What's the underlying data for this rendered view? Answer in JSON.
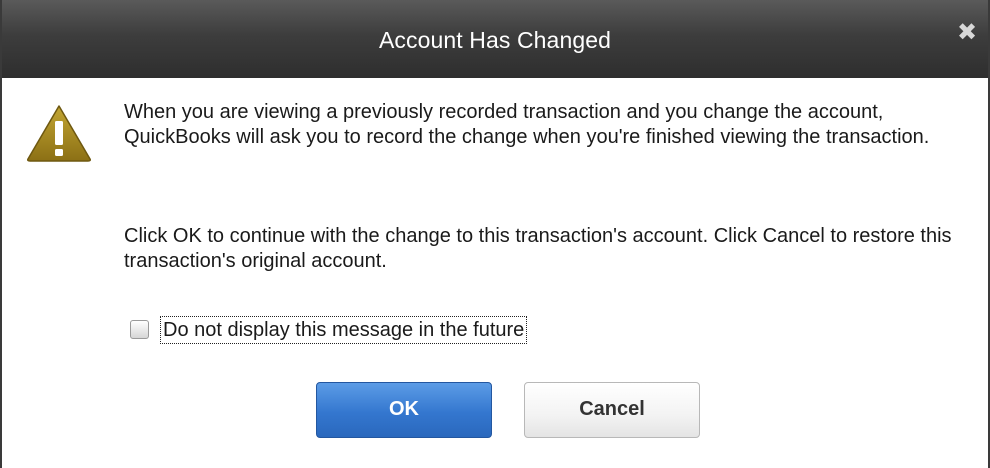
{
  "dialog": {
    "title": "Account Has Changed",
    "close_glyph": "✖",
    "warning_icon": "warning-icon",
    "message_paragraphs": [
      "When you are viewing a previously recorded transaction and you change the account, QuickBooks will ask you to record the change when you're finished viewing the transaction.",
      "Click OK to continue with the change to this transaction's account.  Click Cancel to restore this transaction's original account."
    ],
    "checkbox": {
      "label": "Do not display this message in the future",
      "checked": false
    },
    "buttons": {
      "ok": "OK",
      "cancel": "Cancel"
    },
    "colors": {
      "titlebar": "#3d3d3d",
      "primary_button": "#3477cf",
      "warning_icon": "#a88a1e"
    }
  }
}
